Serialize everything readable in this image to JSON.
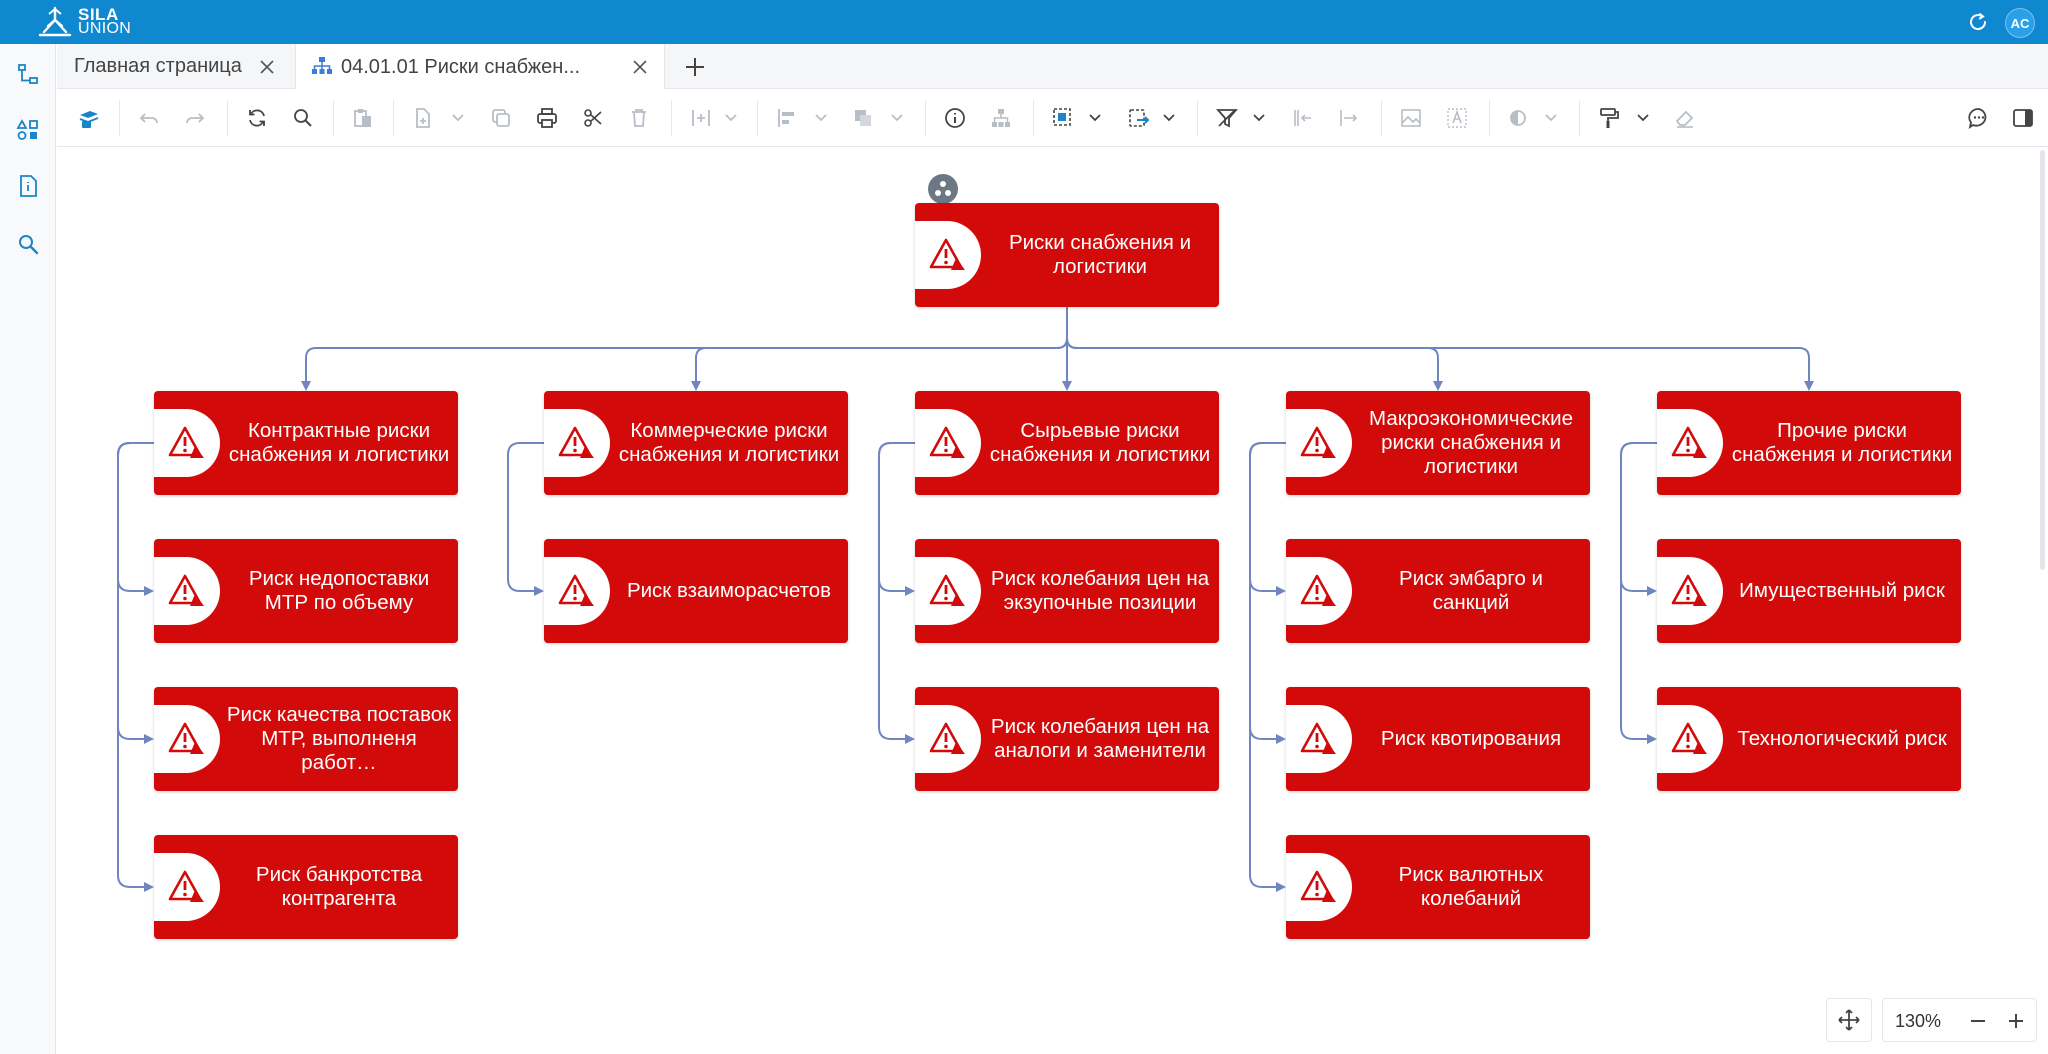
{
  "app": {
    "logo_line1": "SILA",
    "logo_line2": "UNION",
    "user_initials": "AC",
    "brand_color": "#0f88d0"
  },
  "rail": {
    "items": [
      {
        "name": "tree-view-icon"
      },
      {
        "name": "shapes-icon"
      },
      {
        "name": "document-info-icon"
      },
      {
        "name": "search-icon"
      }
    ]
  },
  "tabs": {
    "items": [
      {
        "label": "Главная страница"
      },
      {
        "label": "04.01.01 Риски снабжен..."
      }
    ]
  },
  "diagram": {
    "node_color": "#d20a0a",
    "link_color": "#6f86c0",
    "root": {
      "label": "Риски снабжения и логистики"
    },
    "columns": [
      {
        "header": "Контрактные риски снабжения и логистики",
        "children": [
          "Риск недопоставки МТР по объему",
          "Риск качества поставок МТР, выполненя работ…",
          "Риск банкротства контрагента"
        ]
      },
      {
        "header": "Коммерческие риски снабжения и логистики",
        "children": [
          "Риск взаиморасчетов"
        ]
      },
      {
        "header": "Сырьевые риски снабжения и логистики",
        "children": [
          "Риск колебания цен на экзупочные позиции",
          "Риск колебания цен на аналоги и заменители"
        ]
      },
      {
        "header": "Макроэкономические риски снабжения и логистики",
        "children": [
          "Риск эмбарго и санкций",
          "Риск квотирования",
          "Риск валютных колебаний"
        ]
      },
      {
        "header": "Прочие риски снабжения и логистики",
        "children": [
          "Имущественный риск",
          "Технологический риск"
        ]
      }
    ]
  },
  "zoom": {
    "value": "130%",
    "minus": "−",
    "plus": "+"
  }
}
